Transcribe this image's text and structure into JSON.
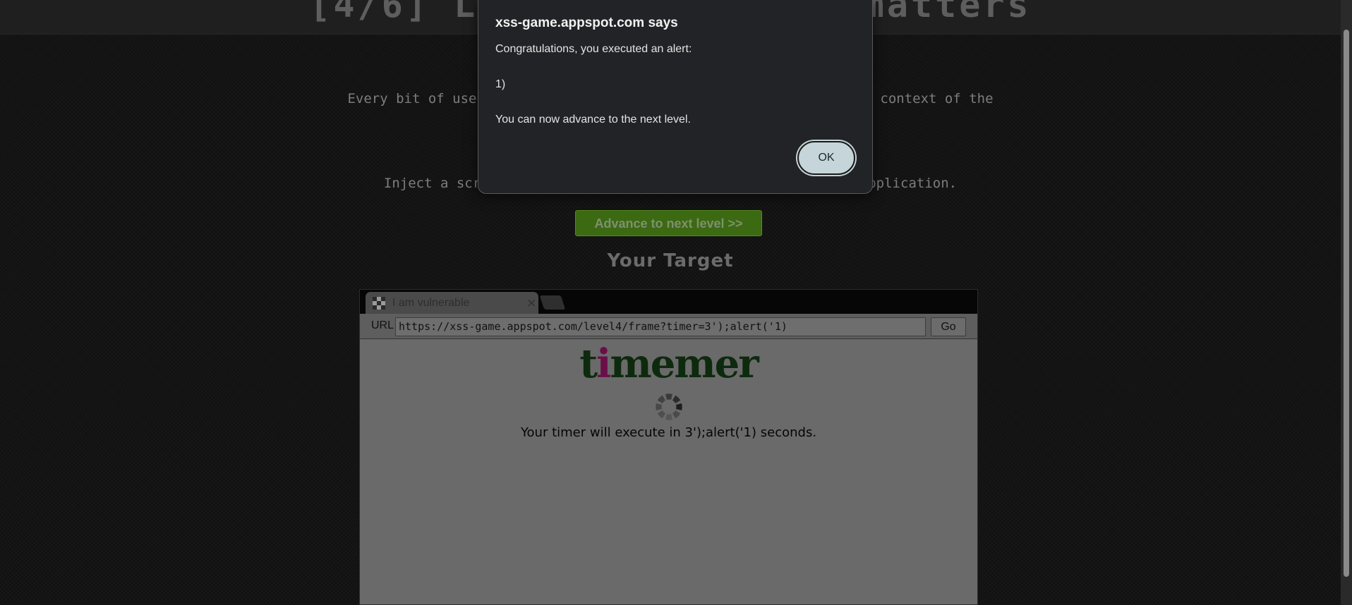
{
  "page": {
    "header_title": "[4/6] Level 4: Context matters",
    "description": "Every bit of user-supplied data must be correctly escaped for the context of the page in which it will appear.",
    "mission": "Inject a script to pop up an alert() in the context of the application.",
    "advance_button": "Advance to next level >>",
    "target_heading": "Your Target"
  },
  "frame": {
    "tab_title": "I am vulnerable",
    "tab_close": "×",
    "url_label": "URL",
    "url_value": "https://xss-game.appspot.com/level4/frame?timer=3');alert('1)",
    "go_label": "Go",
    "logo_prefix": "t",
    "logo_accent": "i",
    "logo_suffix": "memer",
    "timer_text": "Your timer will execute in 3');alert('1) seconds."
  },
  "dialog": {
    "title": "xss-game.appspot.com says",
    "line1": "Congratulations, you executed an alert:",
    "line2": "1)",
    "line3": "You can now advance to the next level.",
    "ok_label": "OK"
  },
  "colors": {
    "advance_button_bg": "#3c6a12",
    "ok_button_bg": "#c5d5d9",
    "logo_accent": "#6a0e48",
    "logo_main": "#0e2a0e"
  }
}
